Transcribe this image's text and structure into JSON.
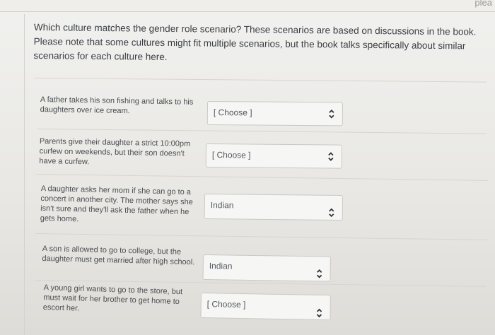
{
  "corner_text": "plea",
  "question": {
    "prompt": "Which culture matches the gender role scenario? These scenarios are based on discussions in the book. Please note that some cultures might fit multiple scenarios, but the book talks specifically about similar scenarios for each culture here."
  },
  "rows": [
    {
      "text": "A father takes his son fishing and talks to his daughters over ice cream.",
      "selected": "[ Choose ]"
    },
    {
      "text": "Parents give their daughter a strict 10:00pm curfew on weekends, but their son doesn't have a curfew.",
      "selected": "[ Choose ]"
    },
    {
      "text": "A daughter asks her mom if she can go to a concert in another city. The mother says she isn't sure and they'll ask the father when he gets home.",
      "selected": "Indian"
    },
    {
      "text": "A son is allowed to go to college, but the daughter must get married after high school.",
      "selected": "Indian"
    },
    {
      "text": "A young girl wants to go to the store, but must wait for her brother to get home to escort her.",
      "selected": "[ Choose ]"
    }
  ],
  "icons": {
    "select_arrow": "up-down-chevron-icon"
  }
}
